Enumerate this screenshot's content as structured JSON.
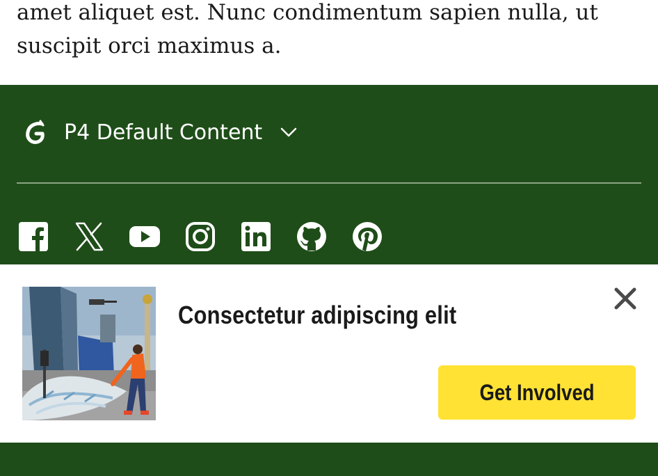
{
  "article": {
    "body_line_1": "amet aliquet est. Nunc condimentum sapien nulla, ut",
    "body_line_2": "suscipit orci maximus a."
  },
  "footer": {
    "background": "#1f4d19",
    "brand_label": "P4 Default Content",
    "logo_icon": "greenpeace-g-logo",
    "menu_icon": "chevron-down-icon",
    "social_links": [
      {
        "name": "facebook",
        "icon": "facebook-icon"
      },
      {
        "name": "x",
        "icon": "x-twitter-icon"
      },
      {
        "name": "youtube",
        "icon": "youtube-icon"
      },
      {
        "name": "instagram",
        "icon": "instagram-icon"
      },
      {
        "name": "linkedin",
        "icon": "linkedin-icon"
      },
      {
        "name": "github",
        "icon": "github-icon"
      },
      {
        "name": "pinterest",
        "icon": "pinterest-icon"
      }
    ]
  },
  "banner": {
    "title": "Consectetur adipiscing elit",
    "cta_label": "Get Involved",
    "cta_color": "#ffe234",
    "close_icon": "close-icon",
    "image_alt": "Person dragging a large net of plastic bottles through a city street"
  }
}
